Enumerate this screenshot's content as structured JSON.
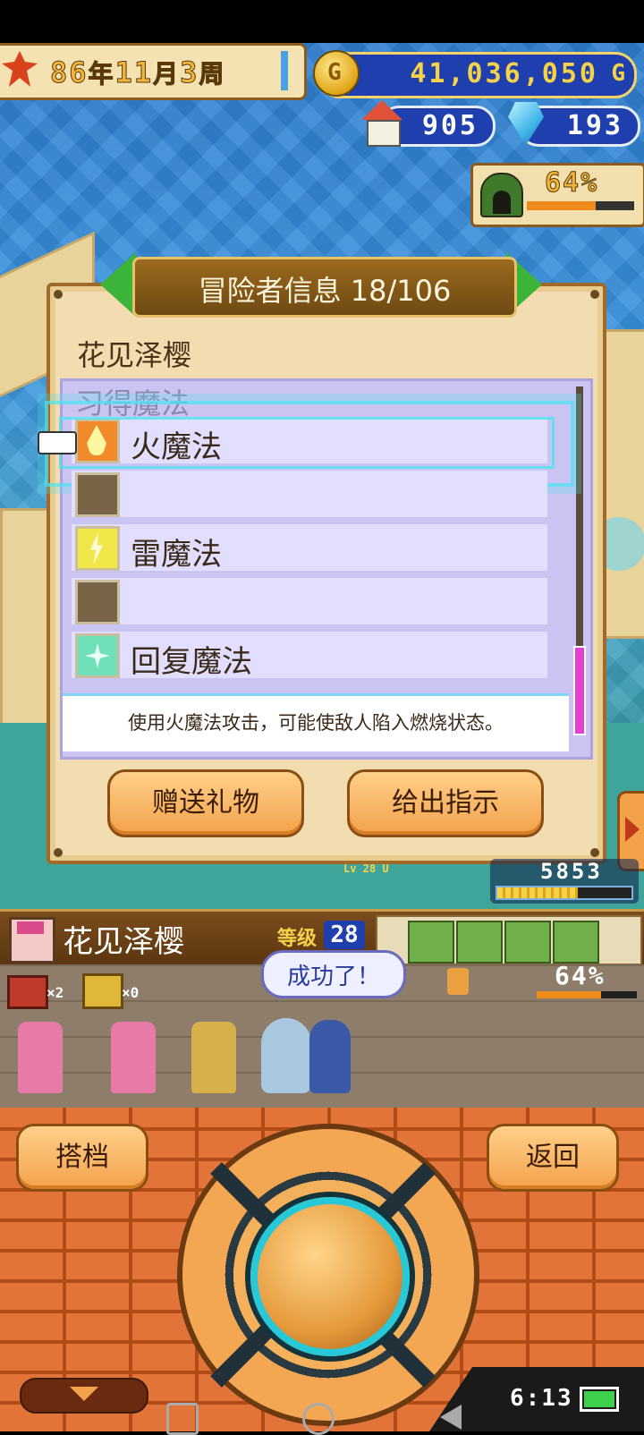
{
  "top": {
    "date": {
      "year": "86",
      "year_unit": "年",
      "month": "11",
      "month_unit": "月",
      "week": "3",
      "week_unit": "周"
    },
    "gold": "41,036,050",
    "gold_unit": "G",
    "gold_icon_letter": "G",
    "houses": "905",
    "crystals": "193",
    "rank_percent": "64%",
    "rank_fill": 0.64
  },
  "dialog": {
    "title": "冒险者信息 18/106",
    "character_name": "花见泽樱",
    "section_label": "习得魔法",
    "skills": [
      {
        "name": "火魔法",
        "icon": "fire-icon",
        "color": "#f08a2a"
      },
      {
        "name": "",
        "icon": "empty-slot",
        "color": "#7a6448"
      },
      {
        "name": "雷魔法",
        "icon": "lightning-icon",
        "color": "#f1e64a"
      },
      {
        "name": "",
        "icon": "empty-slot",
        "color": "#7a6448"
      },
      {
        "name": "回复魔法",
        "icon": "sparkle-icon",
        "color": "#6fe0b8"
      }
    ],
    "description": "使用火魔法攻击，可能使敌人陷入燃烧状态。",
    "gift_button": "赠送礼物",
    "instruct_button": "给出指示"
  },
  "field": {
    "hp_number": "5853",
    "unit_label_small": "Lv 28 U"
  },
  "info_strip": {
    "name": "花见泽樱",
    "level_label": "等级",
    "level": "28"
  },
  "dungeon": {
    "chest_red_count": "×2",
    "chest_gold_count": "×0",
    "speech": "成功了！",
    "progress_percent": "64%",
    "progress_fill": 0.64
  },
  "bottom": {
    "partner_button": "搭档",
    "back_button": "返回",
    "clock": "6:13",
    "battery_fill": 1.0
  },
  "colors": {
    "panel_brown": "#a06a2a",
    "selection_cyan": "#4ee3f0",
    "scroll_pink": "#e43fd0"
  }
}
